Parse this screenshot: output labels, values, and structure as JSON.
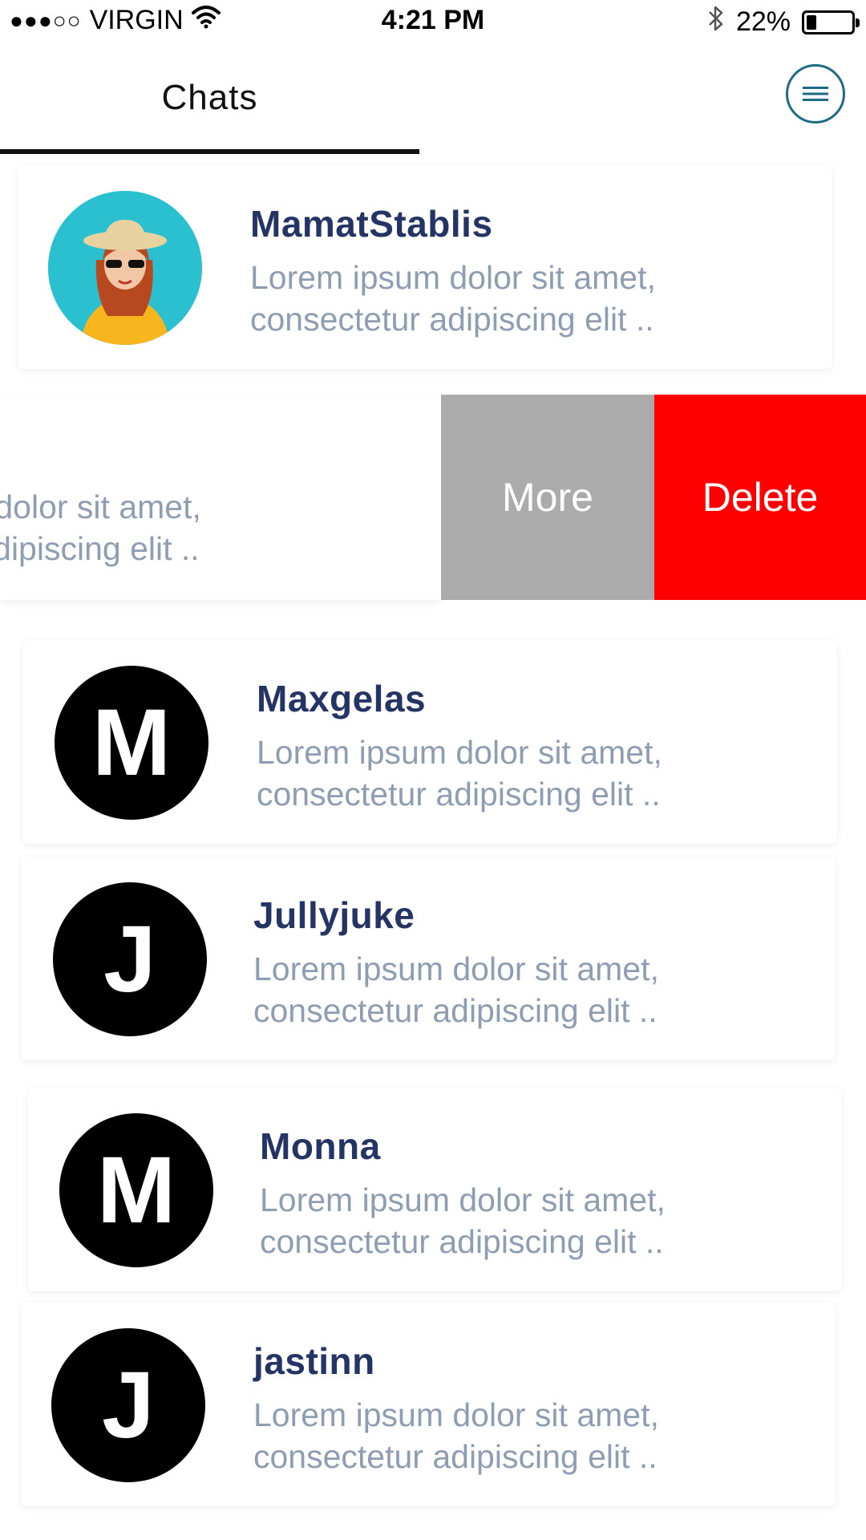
{
  "status_bar": {
    "carrier": "VIRGIN",
    "signal_dots": "●●●○○",
    "time": "4:21 PM",
    "battery": "22%",
    "battery_level": 0.22
  },
  "header": {
    "tab_label": "Chats",
    "menu_icon": "menu-icon"
  },
  "chats": [
    {
      "name": "MamatStablis",
      "line1": "Lorem ipsum dolor sit amet,",
      "line2": "consectetur adipiscing elit .."
    },
    {
      "name": "Maxgelas",
      "initial": "M",
      "line1": "Lorem ipsum dolor sit amet,",
      "line2": "consectetur adipiscing elit .."
    },
    {
      "name": "Jullyjuke",
      "initial": "J",
      "line1": "Lorem ipsum dolor sit amet,",
      "line2": "consectetur adipiscing elit .."
    },
    {
      "name": "Monna",
      "initial": "M",
      "line1": "Lorem ipsum dolor sit amet,",
      "line2": "consectetur adipiscing elit .."
    },
    {
      "name": "jastinn",
      "initial": "J",
      "line1": "Lorem ipsum dolor sit amet,",
      "line2": "consectetur adipiscing elit .."
    }
  ],
  "swiped_row": {
    "line1": "Lorem ipsum dolor sit amet,",
    "line2": "consectetur adipiscing elit ..",
    "more_label": "More",
    "delete_label": "Delete"
  },
  "colors": {
    "name": "#243465",
    "message": "#8f9db3",
    "more": "#ababab",
    "delete": "#ff0000",
    "menu_accent": "#1d6b86"
  }
}
